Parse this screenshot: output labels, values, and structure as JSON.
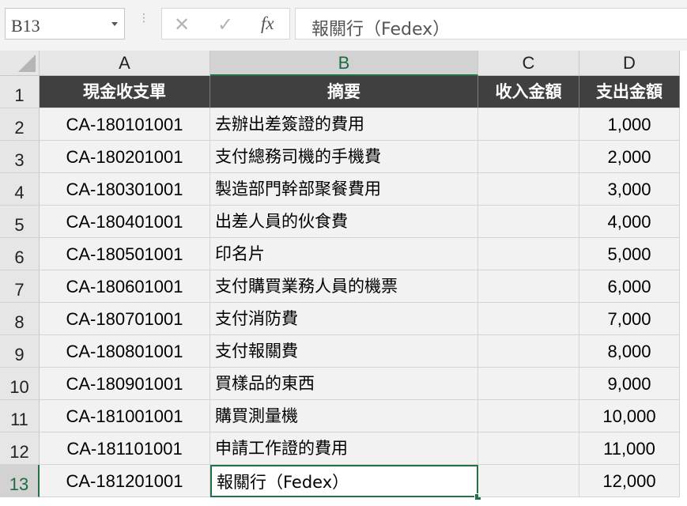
{
  "formula_bar": {
    "name_box": "B13",
    "cancel_icon": "✕",
    "enter_icon": "✓",
    "fx_label": "fx",
    "formula": "報關行（Fedex）"
  },
  "columns": [
    "A",
    "B",
    "C",
    "D"
  ],
  "selected_column": "B",
  "rows": [
    "1",
    "2",
    "3",
    "4",
    "5",
    "6",
    "7",
    "8",
    "9",
    "10",
    "11",
    "12",
    "13"
  ],
  "selected_row": "13",
  "header": {
    "a": "現金收支單",
    "b": "摘要",
    "c": "收入金額",
    "d": "支出金額"
  },
  "data_rows": [
    {
      "a": "CA-180101001",
      "b": "去辦出差簽證的費用",
      "c": "",
      "d": "1,000"
    },
    {
      "a": "CA-180201001",
      "b": "支付總務司機的手機費",
      "c": "",
      "d": "2,000"
    },
    {
      "a": "CA-180301001",
      "b": "製造部門幹部聚餐費用",
      "c": "",
      "d": "3,000"
    },
    {
      "a": "CA-180401001",
      "b": "出差人員的伙食費",
      "c": "",
      "d": "4,000"
    },
    {
      "a": "CA-180501001",
      "b": "印名片",
      "c": "",
      "d": "5,000"
    },
    {
      "a": "CA-180601001",
      "b": "支付購買業務人員的機票",
      "c": "",
      "d": "6,000"
    },
    {
      "a": "CA-180701001",
      "b": "支付消防費",
      "c": "",
      "d": "7,000"
    },
    {
      "a": "CA-180801001",
      "b": "支付報關費",
      "c": "",
      "d": "8,000"
    },
    {
      "a": "CA-180901001",
      "b": "買樣品的東西",
      "c": "",
      "d": "9,000"
    },
    {
      "a": "CA-181001001",
      "b": "購買測量機",
      "c": "",
      "d": "10,000"
    },
    {
      "a": "CA-181101001",
      "b": "申請工作證的費用",
      "c": "",
      "d": "11,000"
    },
    {
      "a": "CA-181201001",
      "b": "報關行（Fedex）",
      "c": "",
      "d": "12,000"
    }
  ],
  "colors": {
    "header_fill": "#404040",
    "cell_fill": "#f2f2f2",
    "selection": "#217346"
  }
}
